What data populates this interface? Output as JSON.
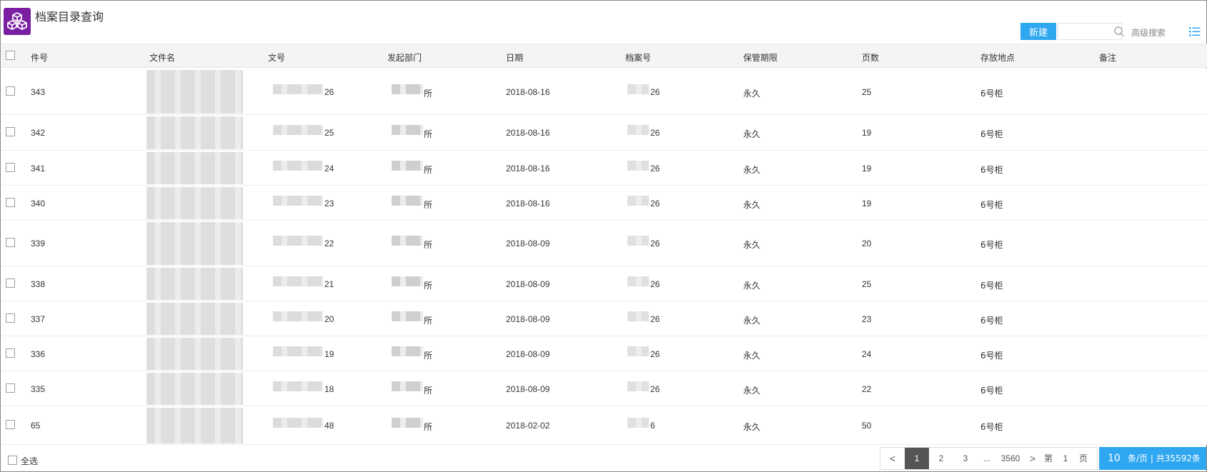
{
  "app": {
    "title": "档案目录查询",
    "logo_icon": "cubes-icon",
    "accent": "#7a1fa2"
  },
  "toolbar": {
    "new_label": "新建",
    "search_value": "",
    "search_icon": "search-icon",
    "advanced_label": "高级搜索",
    "view_icon": "list-view-icon",
    "accent": "#2ea7f0"
  },
  "columns": [
    "件号",
    "文件名",
    "文号",
    "发起部门",
    "日期",
    "档案号",
    "保管期限",
    "页数",
    "存放地点",
    "备注"
  ],
  "rows": [
    {
      "jianhao": "343",
      "wenhao_suffix": "26",
      "dept_suffix": "所",
      "date": "2018-08-16",
      "archive_suffix": "26",
      "retention": "永久",
      "pages": "25",
      "location": "6号柜",
      "note": ""
    },
    {
      "jianhao": "342",
      "wenhao_suffix": "25",
      "dept_suffix": "所",
      "date": "2018-08-16",
      "archive_suffix": "26",
      "retention": "永久",
      "pages": "19",
      "location": "6号柜",
      "note": ""
    },
    {
      "jianhao": "341",
      "wenhao_suffix": "24",
      "dept_suffix": "所",
      "date": "2018-08-16",
      "archive_suffix": "26",
      "retention": "永久",
      "pages": "19",
      "location": "6号柜",
      "note": ""
    },
    {
      "jianhao": "340",
      "wenhao_suffix": "23",
      "dept_suffix": "所",
      "date": "2018-08-16",
      "archive_suffix": "26",
      "retention": "永久",
      "pages": "19",
      "location": "6号柜",
      "note": ""
    },
    {
      "jianhao": "339",
      "wenhao_suffix": "22",
      "dept_suffix": "所",
      "date": "2018-08-09",
      "archive_suffix": "26",
      "retention": "永久",
      "pages": "20",
      "location": "6号柜",
      "note": ""
    },
    {
      "jianhao": "338",
      "wenhao_suffix": "21",
      "dept_suffix": "所",
      "date": "2018-08-09",
      "archive_suffix": "26",
      "retention": "永久",
      "pages": "25",
      "location": "6号柜",
      "note": ""
    },
    {
      "jianhao": "337",
      "wenhao_suffix": "20",
      "dept_suffix": "所",
      "date": "2018-08-09",
      "archive_suffix": "26",
      "retention": "永久",
      "pages": "23",
      "location": "6号柜",
      "note": ""
    },
    {
      "jianhao": "336",
      "wenhao_suffix": "19",
      "dept_suffix": "所",
      "date": "2018-08-09",
      "archive_suffix": "26",
      "retention": "永久",
      "pages": "24",
      "location": "6号柜",
      "note": ""
    },
    {
      "jianhao": "335",
      "wenhao_suffix": "18",
      "dept_suffix": "所",
      "date": "2018-08-09",
      "archive_suffix": "26",
      "retention": "永久",
      "pages": "22",
      "location": "6号柜",
      "note": ""
    },
    {
      "jianhao": "65",
      "wenhao_suffix": "48",
      "dept_suffix": "所",
      "date": "2018-02-02",
      "archive_suffix": "6",
      "retention": "永久",
      "pages": "50",
      "location": "6号柜",
      "note": ""
    }
  ],
  "footer": {
    "select_all_label": "全选",
    "pager": {
      "prev": "<",
      "pages": [
        "1",
        "2",
        "3"
      ],
      "current": "1",
      "ellipsis": "...",
      "last": "3560",
      "next": ">",
      "goto_prefix": "第",
      "goto_value": "1",
      "goto_suffix": "页"
    },
    "page_size": "10",
    "page_size_text": "条/页 | 共35592条"
  }
}
